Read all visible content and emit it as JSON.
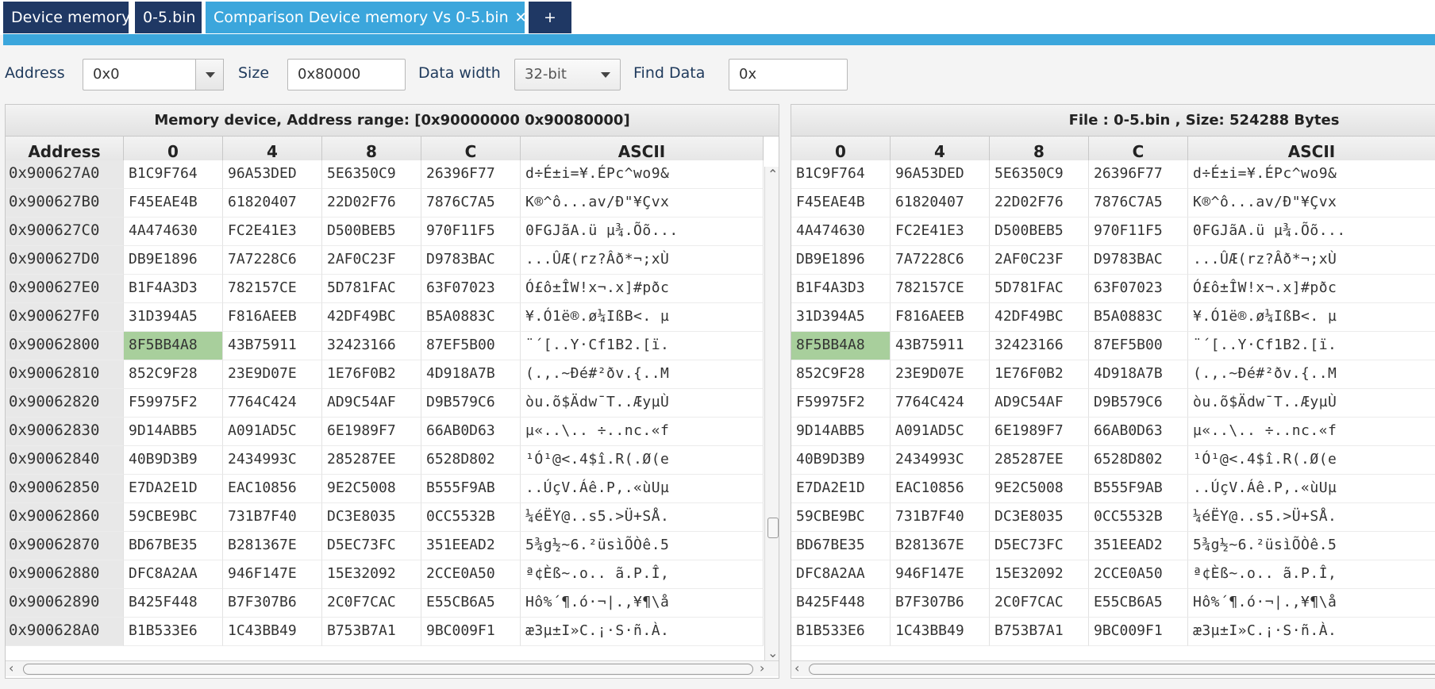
{
  "tabs": [
    {
      "label": "Device memory",
      "active": false
    },
    {
      "label": "0-5.bin",
      "active": false
    },
    {
      "label": "Comparison Device memory Vs 0-5.bin",
      "active": true,
      "close": "✕"
    },
    {
      "label": "+",
      "active": false
    }
  ],
  "toolbar": {
    "address_label": "Address",
    "address_value": "0x0",
    "size_label": "Size",
    "size_value": "0x80000",
    "width_label": "Data width",
    "width_value": "32-bit",
    "find_label": "Find Data",
    "find_value": "0x"
  },
  "left_pane": {
    "title": "Memory device, Address range: [0x90000000 0x90080000]",
    "columns": [
      "Address",
      "0",
      "4",
      "8",
      "C",
      "ASCII"
    ]
  },
  "right_pane": {
    "title": "File : 0-5.bin , Size: 524288 Bytes",
    "columns": [
      "0",
      "4",
      "8",
      "C",
      "ASCII"
    ]
  },
  "highlight_color": "#a8cf9c",
  "rows": [
    {
      "addr": "0x900627A0",
      "w": [
        "B1C9F764",
        "96A53DED",
        "5E6350C9",
        "26396F77"
      ],
      "ascii": "d÷É±i=¥.ÉPc^wo9&"
    },
    {
      "addr": "0x900627B0",
      "w": [
        "F45EAE4B",
        "61820407",
        "22D02F76",
        "7876C7A5"
      ],
      "ascii": "K®^ô...av/Ð\"¥Çvx"
    },
    {
      "addr": "0x900627C0",
      "w": [
        "4A474630",
        "FC2E41E3",
        "D500BEB5",
        "970F11F5"
      ],
      "ascii": "0FGJãA.ü µ¾.Õõ..."
    },
    {
      "addr": "0x900627D0",
      "w": [
        "DB9E1896",
        "7A7228C6",
        "2AF0C23F",
        "D9783BAC"
      ],
      "ascii": "...ÛÆ(rz?Âð*¬;xÙ"
    },
    {
      "addr": "0x900627E0",
      "w": [
        "B1F4A3D3",
        "782157CE",
        "5D781FAC",
        "63F07023"
      ],
      "ascii": "Ó£ô±ÎW!x¬.x]#pðc"
    },
    {
      "addr": "0x900627F0",
      "w": [
        "31D394A5",
        "F816AEEB",
        "42DF49BC",
        "B5A0883C"
      ],
      "ascii": "¥.Ó1ë®.ø¼IßB<. µ"
    },
    {
      "addr": "0x90062800",
      "w": [
        "8F5BB4A8",
        "43B75911",
        "32423166",
        "87EF5B00"
      ],
      "ascii": "¨´[..Y·Cf1B2.[ï.",
      "hl": 0
    },
    {
      "addr": "0x90062810",
      "w": [
        "852C9F28",
        "23E9D07E",
        "1E76F0B2",
        "4D918A7B"
      ],
      "ascii": "(.,.~Ðé#²ðv.{..M"
    },
    {
      "addr": "0x90062820",
      "w": [
        "F59975F2",
        "7764C424",
        "AD9C54AF",
        "D9B579C6"
      ],
      "ascii": "òu.õ$Ädw¯T..ÆyµÙ"
    },
    {
      "addr": "0x90062830",
      "w": [
        "9D14ABB5",
        "A091AD5C",
        "6E1989F7",
        "66AB0D63"
      ],
      "ascii": "µ«..\\.. ÷..nc.«f"
    },
    {
      "addr": "0x90062840",
      "w": [
        "40B9D3B9",
        "2434993C",
        "285287EE",
        "6528D802"
      ],
      "ascii": "¹Ó¹@<.4$î.R(.Ø(e"
    },
    {
      "addr": "0x90062850",
      "w": [
        "E7DA2E1D",
        "EAC10856",
        "9E2C5008",
        "B555F9AB"
      ],
      "ascii": "..ÚçV.Áê.P,.«ùUµ"
    },
    {
      "addr": "0x90062860",
      "w": [
        "59CBE9BC",
        "731B7F40",
        "DC3E8035",
        "0CC5532B"
      ],
      "ascii": "¼éËY@..s5.>Ü+SÅ."
    },
    {
      "addr": "0x90062870",
      "w": [
        "BD67BE35",
        "B281367E",
        "D5EC73FC",
        "351EEAD2"
      ],
      "ascii": "5¾g½~6.²üsìÕÒê.5"
    },
    {
      "addr": "0x90062880",
      "w": [
        "DFC8A2AA",
        "946F147E",
        "15E32092",
        "2CCE0A50"
      ],
      "ascii": "ª¢Èß~.o.. ã.P.Î,"
    },
    {
      "addr": "0x90062890",
      "w": [
        "B425F448",
        "B7F307B6",
        "2C0F7CAC",
        "E55CB6A5"
      ],
      "ascii": "Hô%´¶.ó·¬|.,¥¶\\å"
    },
    {
      "addr": "0x900628A0",
      "w": [
        "B1B533E6",
        "1C43BB49",
        "B753B7A1",
        "9BC009F1"
      ],
      "ascii": "æ3µ±I»C.¡·S·ñ.À."
    }
  ]
}
